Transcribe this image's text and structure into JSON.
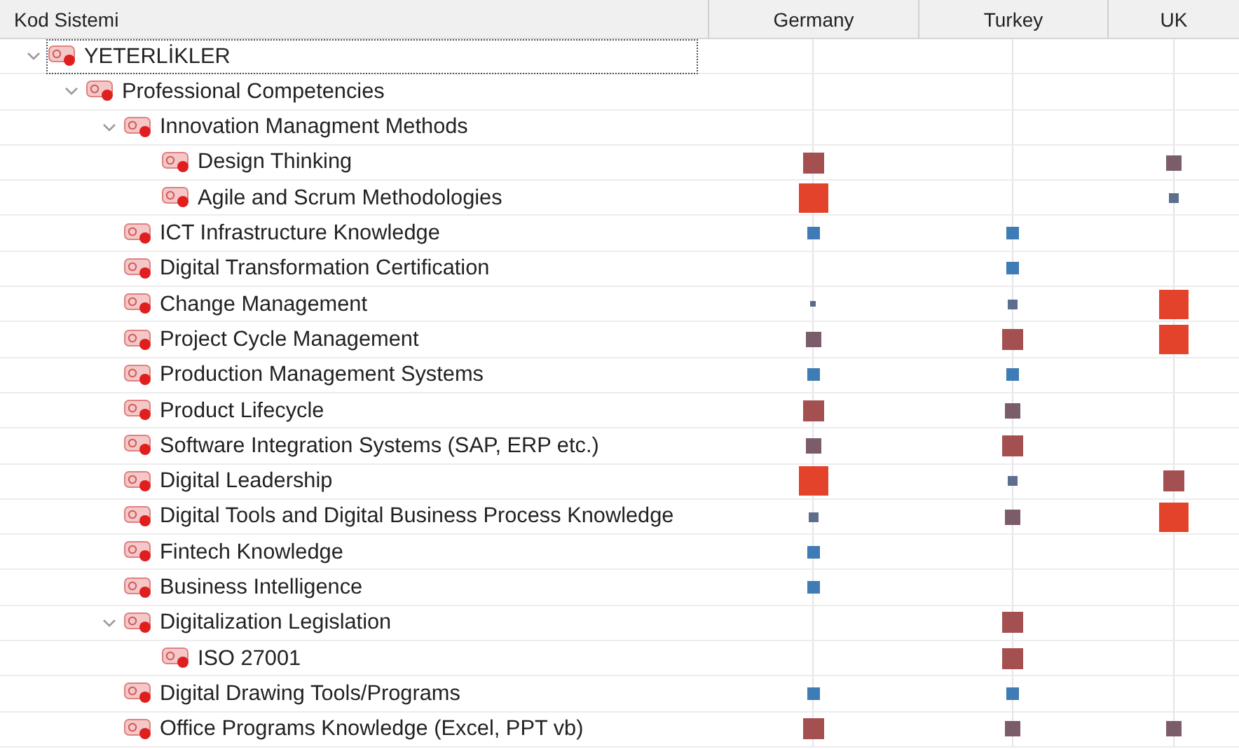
{
  "header": {
    "tree_column": "Kod Sistemi",
    "columns": [
      "Germany",
      "Turkey",
      "UK"
    ]
  },
  "tree": [
    {
      "label": "YETERLİKLER",
      "selected": true,
      "expanded": true,
      "cells": [
        {
          "kind": "none"
        },
        {
          "kind": "none"
        },
        {
          "kind": "none"
        }
      ],
      "children": [
        {
          "label": "Professional Competencies",
          "selected": false,
          "expanded": true,
          "cells": [
            {
              "kind": "none"
            },
            {
              "kind": "none"
            },
            {
              "kind": "none"
            }
          ],
          "children": [
            {
              "label": "Innovation Managment Methods",
              "selected": false,
              "expanded": true,
              "cells": [
                {
                  "kind": "none"
                },
                {
                  "kind": "none"
                },
                {
                  "kind": "none"
                }
              ],
              "children": [
                {
                  "label": "Design Thinking",
                  "selected": false,
                  "cells": [
                    {
                      "kind": "large"
                    },
                    {
                      "kind": "none"
                    },
                    {
                      "kind": "medium"
                    }
                  ]
                },
                {
                  "label": "Agile and Scrum Methodologies",
                  "selected": false,
                  "cells": [
                    {
                      "kind": "huge"
                    },
                    {
                      "kind": "none"
                    },
                    {
                      "kind": "tiny"
                    }
                  ]
                }
              ]
            },
            {
              "label": "ICT Infrastructure Knowledge",
              "selected": false,
              "cells": [
                {
                  "kind": "small"
                },
                {
                  "kind": "small"
                },
                {
                  "kind": "none"
                }
              ]
            },
            {
              "label": "Digital Transformation Certification",
              "selected": false,
              "cells": [
                {
                  "kind": "none"
                },
                {
                  "kind": "small"
                },
                {
                  "kind": "none"
                }
              ]
            },
            {
              "label": "Change Management",
              "selected": false,
              "cells": [
                {
                  "kind": "dot"
                },
                {
                  "kind": "tiny"
                },
                {
                  "kind": "huge"
                }
              ]
            },
            {
              "label": "Project Cycle Management",
              "selected": false,
              "cells": [
                {
                  "kind": "medium"
                },
                {
                  "kind": "large"
                },
                {
                  "kind": "huge"
                }
              ]
            },
            {
              "label": "Production Management Systems",
              "selected": false,
              "cells": [
                {
                  "kind": "small"
                },
                {
                  "kind": "small"
                },
                {
                  "kind": "none"
                }
              ]
            },
            {
              "label": "Product Lifecycle",
              "selected": false,
              "cells": [
                {
                  "kind": "large"
                },
                {
                  "kind": "medium"
                },
                {
                  "kind": "none"
                }
              ]
            },
            {
              "label": "Software Integration Systems (SAP, ERP etc.)",
              "selected": false,
              "cells": [
                {
                  "kind": "medium"
                },
                {
                  "kind": "large"
                },
                {
                  "kind": "none"
                }
              ]
            },
            {
              "label": "Digital Leadership",
              "selected": false,
              "cells": [
                {
                  "kind": "huge"
                },
                {
                  "kind": "tiny"
                },
                {
                  "kind": "large"
                }
              ]
            },
            {
              "label": "Digital Tools and Digital Business Process Knowledge",
              "selected": false,
              "cells": [
                {
                  "kind": "tiny"
                },
                {
                  "kind": "medium"
                },
                {
                  "kind": "huge"
                }
              ]
            },
            {
              "label": "Fintech Knowledge",
              "selected": false,
              "cells": [
                {
                  "kind": "small"
                },
                {
                  "kind": "none"
                },
                {
                  "kind": "none"
                }
              ]
            },
            {
              "label": "Business Intelligence",
              "selected": false,
              "cells": [
                {
                  "kind": "small"
                },
                {
                  "kind": "none"
                },
                {
                  "kind": "none"
                }
              ]
            },
            {
              "label": "Digitalization Legislation",
              "selected": false,
              "expanded": true,
              "cells": [
                {
                  "kind": "none"
                },
                {
                  "kind": "large"
                },
                {
                  "kind": "none"
                }
              ],
              "children": [
                {
                  "label": "ISO 27001",
                  "selected": false,
                  "cells": [
                    {
                      "kind": "none"
                    },
                    {
                      "kind": "large"
                    },
                    {
                      "kind": "none"
                    }
                  ]
                }
              ]
            },
            {
              "label": "Digital Drawing Tools/Programs",
              "selected": false,
              "cells": [
                {
                  "kind": "small"
                },
                {
                  "kind": "small"
                },
                {
                  "kind": "none"
                }
              ]
            },
            {
              "label": "Office Programs Knowledge (Excel, PPT vb)",
              "selected": false,
              "cells": [
                {
                  "kind": "large"
                },
                {
                  "kind": "medium"
                },
                {
                  "kind": "medium"
                }
              ]
            }
          ]
        }
      ]
    }
  ]
}
